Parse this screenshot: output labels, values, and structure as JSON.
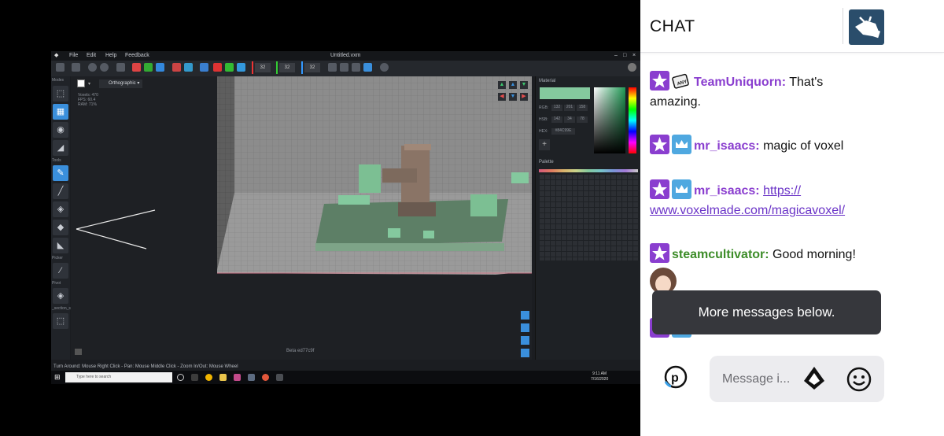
{
  "app": {
    "menu": [
      "File",
      "Edit",
      "Help",
      "Feedback"
    ],
    "title": "Untitled.vxm",
    "toolbar_counts": [
      "32",
      "32",
      "32"
    ],
    "left_labels": {
      "modes": "Modes",
      "tools": "Tools",
      "picker": "Picker",
      "pivot": "Pivot",
      "section": "_section_sc"
    },
    "view_mode": "Orthographic",
    "stats": "Voxels: 470\nFPS: 60.4\nRAM: 71%",
    "material_title": "Material",
    "rgb_label": "RGB:",
    "rgb_values": [
      "132",
      "201",
      "158"
    ],
    "hsb_label": "HSB:",
    "hsb_values": [
      "142",
      "34",
      "78"
    ],
    "hex_label": "HEX:",
    "hex_value": "#84C99E",
    "palette_title": "Palette",
    "version": "Beta ed77c9f",
    "status": "Turn Around: Mouse Right Click - Pan: Mouse Middle Click - Zoom In/Out: Mouse Wheel",
    "taskbar_search": "Type here to search",
    "clock_time": "9:11 AM",
    "clock_date": "7/16/2020",
    "colors": {
      "accent": "#3a8fdc",
      "voxel_green": "#84C99E",
      "voxel_brown": "#8a7466"
    }
  },
  "chat": {
    "title": "CHAT",
    "messages": [
      {
        "badges": [
          "star-badge",
          "any-badge"
        ],
        "user": "TeamUniquorn",
        "user_color": "#8a3ecf",
        "text": "That's amazing."
      },
      {
        "badges": [
          "star-badge",
          "crown-badge"
        ],
        "user": "mr_isaacs",
        "user_color": "#8a3ecf",
        "text": "magic of voxel"
      },
      {
        "badges": [
          "star-badge",
          "crown-badge"
        ],
        "user": "mr_isaacs",
        "user_color": "#8a3ecf",
        "link1": "https://",
        "link2": "www.voxelmade.com/magicavoxel/"
      },
      {
        "badges": [
          "star-badge"
        ],
        "user": "steamcultivator",
        "user_color": "#3e8d2a",
        "text": "Good morning!"
      }
    ],
    "toast": "More messages below.",
    "input_placeholder": "Message i..."
  }
}
